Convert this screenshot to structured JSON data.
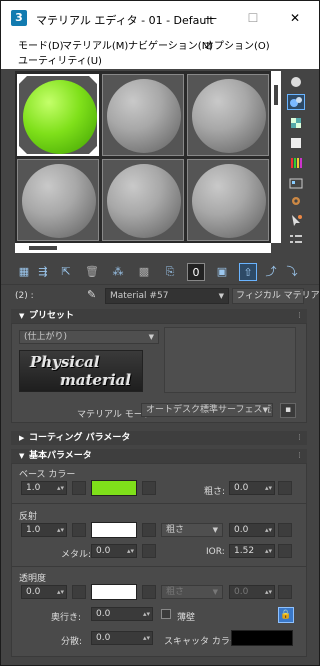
{
  "window": {
    "app_icon": "3",
    "title": "マテリアル エディタ - 01 - Default",
    "minimize": "—",
    "maximize": "☐",
    "close": "✕"
  },
  "menu": {
    "items": [
      "モード(D)",
      "マテリアル(M)",
      "ナビゲーション(N)",
      "オプション(O)",
      "ユーティリティ(U)"
    ]
  },
  "slots": {
    "count": 6,
    "active_index": 0,
    "active_color": "#7fe01a"
  },
  "material": {
    "index_label": "(2) :",
    "name": "Material #57",
    "type": "フィジカル マテリアル"
  },
  "preset_rollout": {
    "title": "プリセット",
    "preset_value": "(仕上がり)",
    "logo_line1": "Physical",
    "logo_line2": "material",
    "mode_label": "マテリアル モード:",
    "mode_value": "オートデスク標準サーフェス互換"
  },
  "coating_rollout": {
    "title": "コーティング パラメータ"
  },
  "basic_rollout": {
    "title": "基本パラメータ",
    "base_color": {
      "label": "ベース カラー",
      "weight": "1.0",
      "color": "#7fe01a",
      "roughness_label": "粗さ:",
      "roughness": "0.0"
    },
    "reflection": {
      "label": "反射",
      "weight": "1.0",
      "color": "#ffffff",
      "rough_dropdown": "粗さ",
      "rough_value": "0.0",
      "metal_label": "メタル:",
      "metal_value": "0.0",
      "ior_label": "IOR:",
      "ior_value": "1.52"
    },
    "transparency": {
      "label": "透明度",
      "weight": "0.0",
      "color": "#ffffff",
      "rough_dropdown": "粗さ",
      "rough_value": "0.0",
      "depth_label": "奥行き:",
      "depth_value": "0.0",
      "thin_label": "薄壁",
      "dispersion_label": "分散:",
      "dispersion_value": "0.0",
      "scatter_label": "スキャッタ カラー:",
      "scatter_color": "#000000"
    }
  }
}
